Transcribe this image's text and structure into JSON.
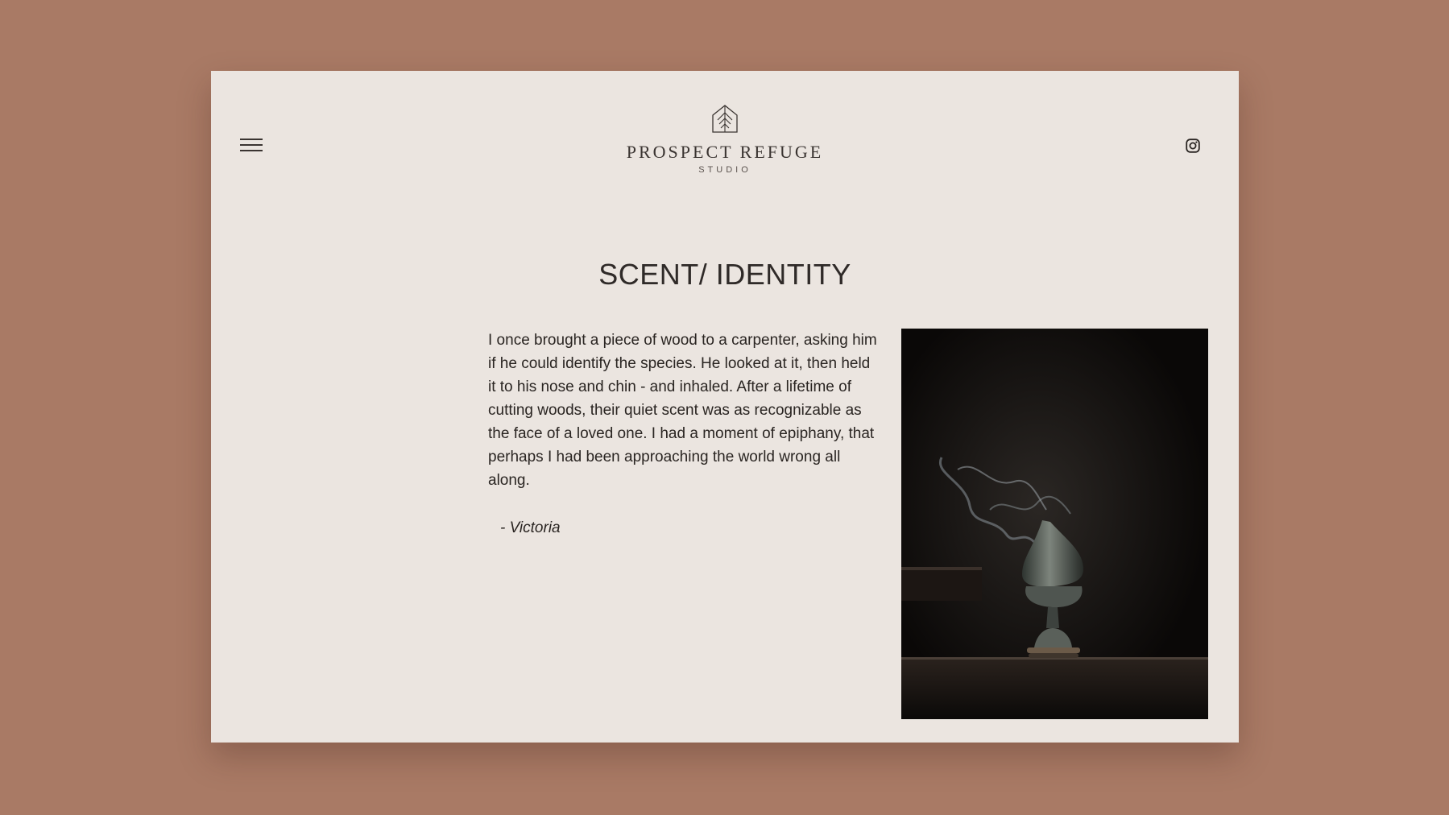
{
  "header": {
    "menu_icon": "hamburger-menu-icon",
    "logo": {
      "title": "PROSPECT REFUGE",
      "subtitle": "STUDIO",
      "mark_icon": "house-tree-logo-icon"
    },
    "social_icon": "instagram-icon"
  },
  "main": {
    "title": "SCENT/ IDENTITY",
    "story": "I once brought a piece of wood to a carpenter, asking him if he could identify the species. He looked at it, then held it to his nose and chin - and inhaled. After a lifetime of cutting woods, their quiet scent was as recognizable as the face of a loved one. I had a moment of epiphany, that perhaps I had been approaching the world wrong all along.",
    "author": "- Victoria",
    "photo_subject": "incense-burner-smoke-photo"
  },
  "colors": {
    "background": "#a97a65",
    "card": "#ebe5e0",
    "text": "#2a2522"
  }
}
